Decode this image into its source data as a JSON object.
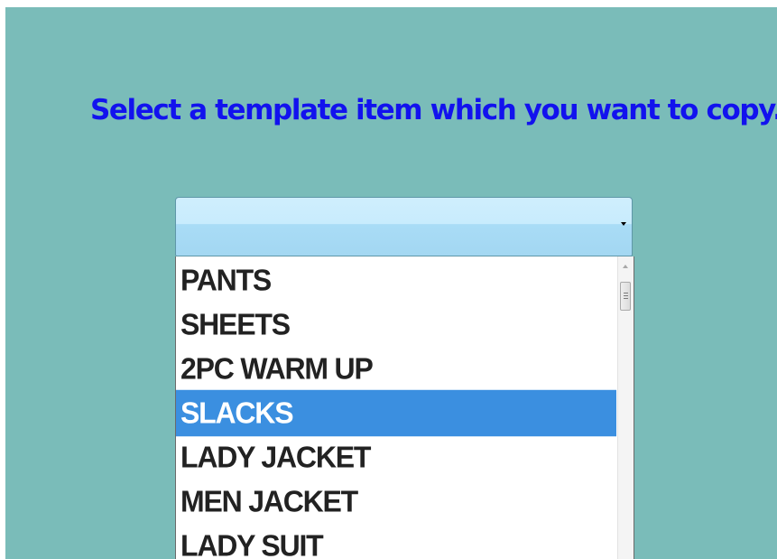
{
  "heading": "Select a template item which you want to copy.",
  "dropdown": {
    "selected_value": ""
  },
  "options": [
    "PANTS",
    "SHEETS",
    "2PC WARM UP",
    "SLACKS",
    "LADY JACKET",
    "MEN JACKET",
    "LADY SUIT"
  ],
  "highlighted_option": "SLACKS",
  "colors": {
    "background": "#7abcb9",
    "heading": "#1212ee",
    "highlight": "#3b8fe0",
    "dropdown_top": "#cfeefd",
    "dropdown_bottom": "#a3d7f2"
  }
}
